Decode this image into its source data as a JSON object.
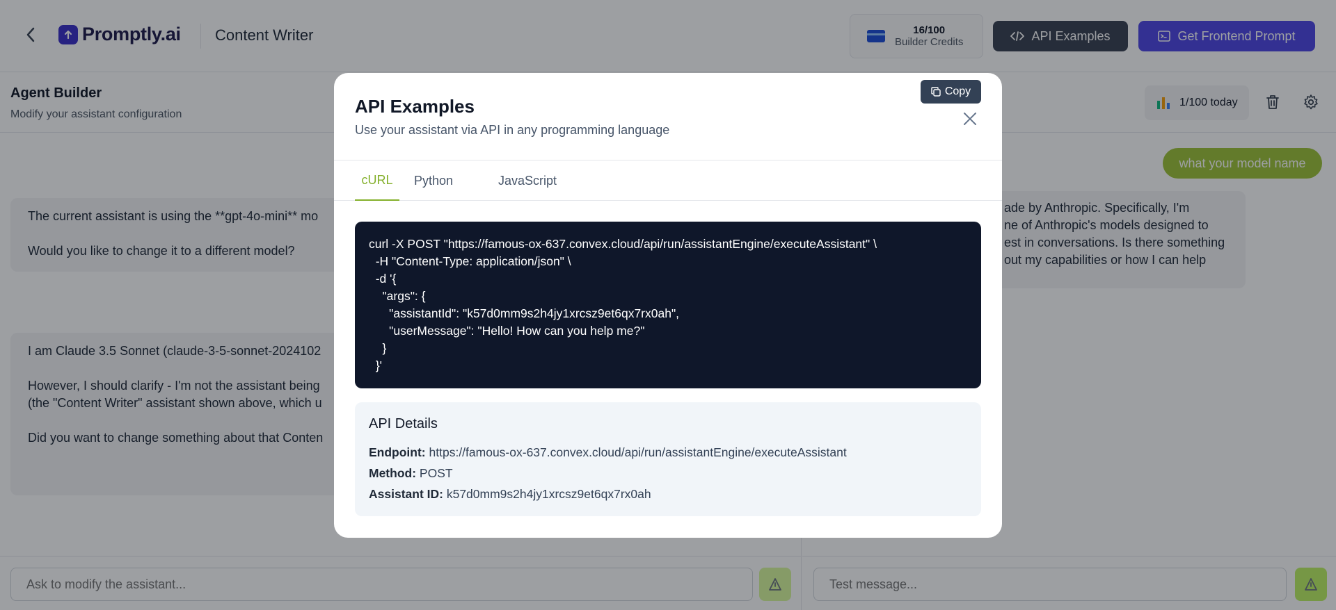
{
  "header": {
    "brand": "Promptly.ai",
    "app_title": "Content Writer",
    "credits_count": "16/100",
    "credits_label": "Builder Credits",
    "api_examples_label": "API Examples",
    "frontend_prompt_label": "Get Frontend Prompt"
  },
  "builder": {
    "title": "Agent Builder",
    "subtitle": "Modify your assistant configuration",
    "messages": [
      "The current assistant is using the **gpt-4o-mini** mo\n\nWould you like to change it to a different model?",
      "I am Claude 3.5 Sonnet (claude-3-5-sonnet-2024102\n\nHowever, I should clarify - I'm not the assistant being\n(the \"Content Writer\" assistant shown above, which u\n\nDid you want to change something about that Conten"
    ],
    "input_placeholder": "Ask to modify the assistant..."
  },
  "tester": {
    "usage": "1/100 today",
    "user_message": "what your model name",
    "bot_message": "ade by Anthropic. Specifically, I'm\nne of Anthropic's models designed to\nest in conversations. Is there something\nout my capabilities or how I can help",
    "input_placeholder": "Test message..."
  },
  "modal": {
    "title": "API Examples",
    "subtitle": "Use your assistant via API in any programming language",
    "tabs": [
      "cURL",
      "Python",
      "JavaScript"
    ],
    "active_tab": "cURL",
    "copy_label": "Copy",
    "code_lines": [
      "curl -X POST \"https://famous-ox-637.convex.cloud/api/run/assistantEngine/executeAssistant\" \\",
      "  -H \"Content-Type: application/json\" \\",
      "  -d '{",
      "    \"args\": {",
      "      \"assistantId\": \"k57d0mm9s2h4jy1xrcsz9et6qx7rx0ah\",",
      "      \"userMessage\": \"Hello! How can you help me?\"",
      "    }",
      "  }'"
    ],
    "details": {
      "title": "API Details",
      "endpoint_label": "Endpoint:",
      "endpoint": "https://famous-ox-637.convex.cloud/api/run/assistantEngine/executeAssistant",
      "method_label": "Method:",
      "method": "POST",
      "assistant_id_label": "Assistant ID:",
      "assistant_id": "k57d0mm9s2h4jy1xrcsz9et6qx7rx0ah"
    }
  },
  "colors": {
    "brand": "#3b2fc9",
    "accent_green": "#84b02b",
    "code_bg": "#0f172a",
    "frontend_btn": "#4f46e5",
    "api_btn": "#3a4252"
  },
  "icons": [
    "back-arrow-icon",
    "logo-upload-icon",
    "credit-card-icon",
    "code-icon",
    "terminal-icon",
    "bar-chart-icon",
    "trash-icon",
    "gear-icon",
    "send-icon",
    "close-icon",
    "copy-icon"
  ]
}
